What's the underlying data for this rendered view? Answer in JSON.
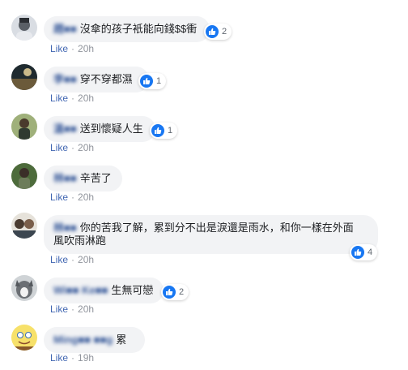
{
  "comments": [
    {
      "name": "趙■■",
      "text": "沒傘的孩子衹能向錢$$衝",
      "reactions": "2",
      "like_label": "Like",
      "time": "20h"
    },
    {
      "name": "李■■",
      "text": "穿不穿都濕",
      "reactions": "1",
      "like_label": "Like",
      "time": "20h"
    },
    {
      "name": "溫■■",
      "text": "送到懷疑人生",
      "reactions": "1",
      "like_label": "Like",
      "time": "20h"
    },
    {
      "name": "林■■",
      "text": "辛苦了",
      "like_label": "Like",
      "time": "20h"
    },
    {
      "name": "林■■",
      "text": "你的苦我了解，累到分不出是淚還是雨水，和你一樣在外面",
      "text2": "風吹雨淋跑",
      "reactions": "4",
      "like_label": "Like",
      "time": "20h"
    },
    {
      "name": "Wi■■ Ke■■",
      "text": "生無可戀",
      "reactions": "2",
      "like_label": "Like",
      "time": "20h"
    },
    {
      "name": "Ming■■ ■■g",
      "text": "累",
      "like_label": "Like",
      "time": "19h"
    }
  ],
  "colors": {
    "like_blue": "#1877f2",
    "name_blue": "#365899",
    "bubble_bg": "#f2f3f5",
    "meta_grey": "#90949c"
  }
}
